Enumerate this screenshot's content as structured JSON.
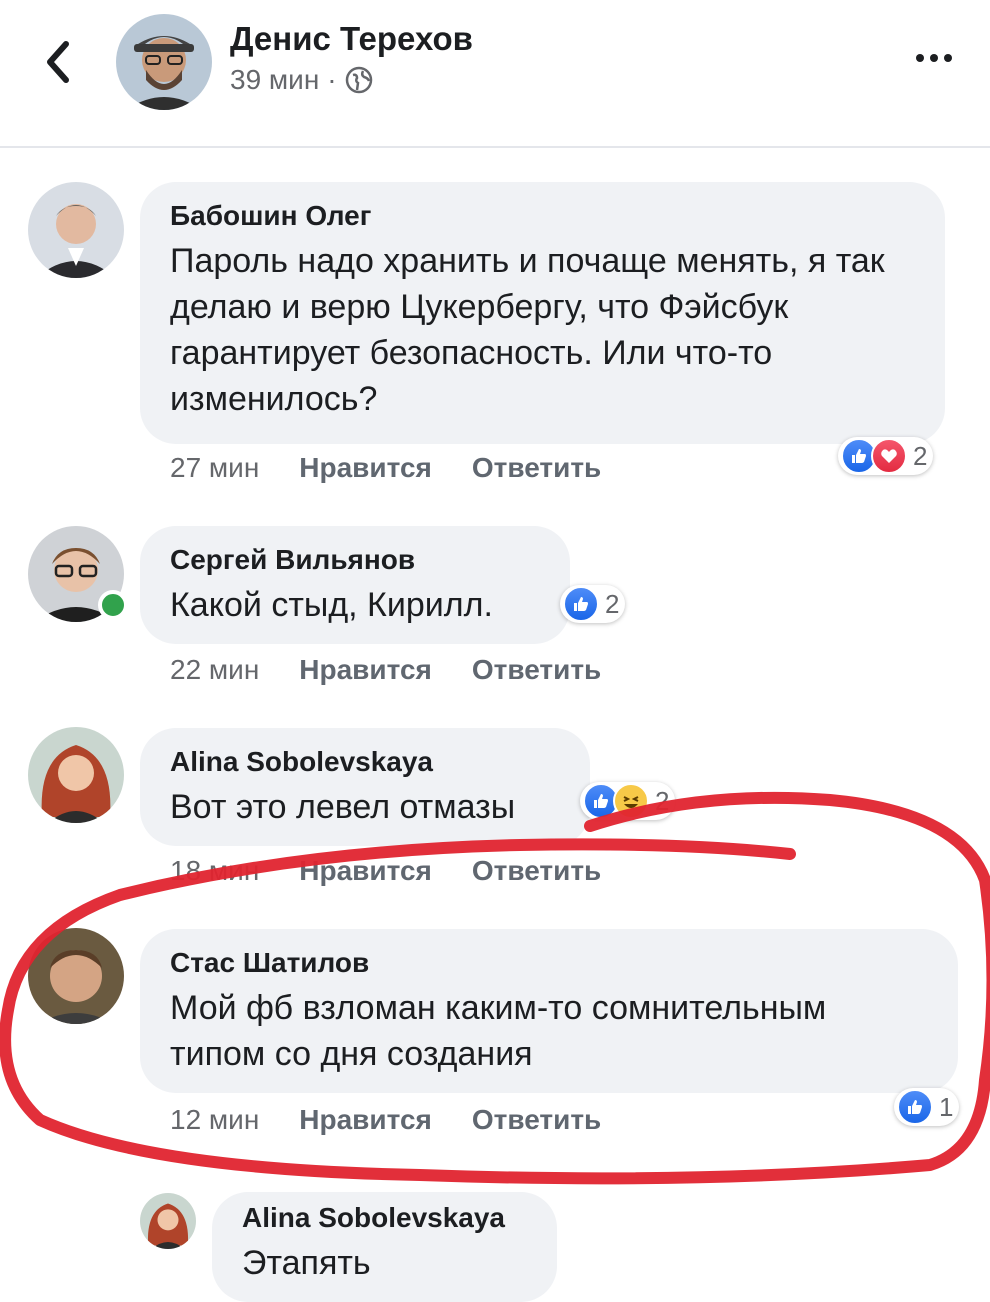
{
  "header": {
    "author": "Денис Терехов",
    "time": "39 мин",
    "separator": "·"
  },
  "comments": [
    {
      "author": "Бабошин Олег",
      "text": "Пароль надо хранить и почаще менять, я так делаю и верю Цукербергу, что Фэйсбук гарантирует безопасность. Или что-то изменилось?",
      "time": "27 мин",
      "like_label": "Нравится",
      "reply_label": "Ответить",
      "reactions": [
        "like",
        "love"
      ],
      "reaction_count": "2"
    },
    {
      "author": "Сергей Вильянов",
      "text": "Какой стыд, Кирилл.",
      "time": "22 мин",
      "like_label": "Нравится",
      "reply_label": "Ответить",
      "reactions": [
        "like"
      ],
      "reaction_count": "2",
      "online": true
    },
    {
      "author": "Alina Sobolevskaya",
      "text": "Вот это левел отмазы",
      "time": "18 мин",
      "like_label": "Нравится",
      "reply_label": "Ответить",
      "reactions": [
        "like",
        "haha"
      ],
      "reaction_count": "2"
    },
    {
      "author": "Стас Шатилов",
      "text": "Мой фб взломан каким-то сомнительным типом со дня создания",
      "time": "12 мин",
      "like_label": "Нравится",
      "reply_label": "Ответить",
      "reactions": [
        "like"
      ],
      "reaction_count": "1"
    }
  ],
  "reply": {
    "author": "Alina Sobolevskaya",
    "text": "Этапять"
  },
  "colors": {
    "bubble": "#f0f2f5",
    "like": "#1a66e8",
    "love": "#e32b41",
    "online": "#31a24c",
    "annotation": "#e0242f"
  }
}
